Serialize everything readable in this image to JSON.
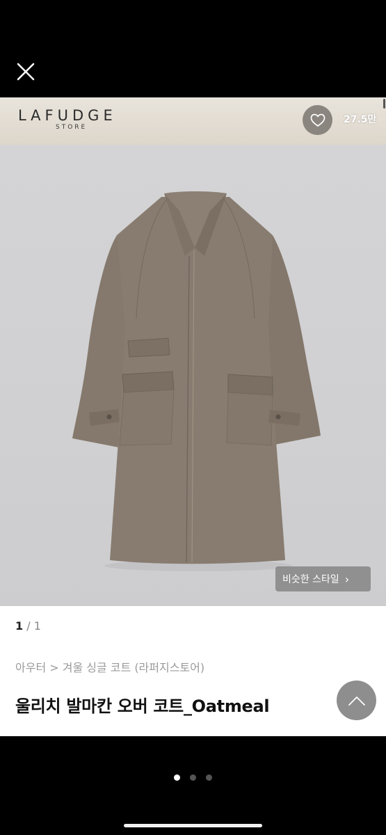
{
  "close": {
    "icon": "close-icon"
  },
  "store": {
    "name": "LAFUDGE",
    "sub": "STORE",
    "like_icon": "heart-outline-icon",
    "like_count": "27.5만"
  },
  "photo": {
    "subject": "coat-image",
    "similar_label": "비슷한 스타일",
    "similar_icon": "chevron-right-icon"
  },
  "pager": {
    "current": "1",
    "separator": "/",
    "total": "1"
  },
  "product": {
    "breadcrumb": "아우터 > 겨울 싱글 코트 (라퍼지스토어)",
    "title": "울리치 발마칸 오버 코트_Oatmeal"
  },
  "scroll_top": {
    "icon": "chevron-up-icon"
  },
  "carousel": {
    "count": 3,
    "active_index": 0
  },
  "colors": {
    "coat": "#85796d",
    "banner": "#e4dfd6",
    "photo_bg": "#d2d2d4",
    "button_gray": "#8e8e8e"
  }
}
